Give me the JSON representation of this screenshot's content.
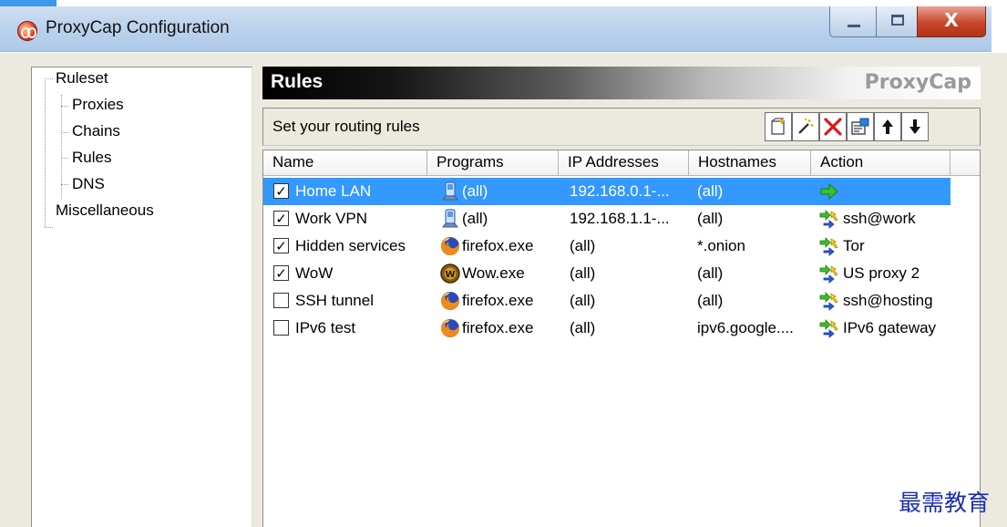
{
  "window": {
    "title": "ProxyCap Configuration",
    "close_label": "X"
  },
  "tree": {
    "root": "Ruleset",
    "children": [
      "Proxies",
      "Chains",
      "Rules",
      "DNS"
    ],
    "other": "Miscellaneous"
  },
  "rules": {
    "header": "Rules",
    "brand": "ProxyCap",
    "subtitle": "Set your routing rules",
    "toolbar": [
      "new-rule-icon",
      "wizard-icon",
      "delete-icon",
      "properties-icon",
      "move-up-icon",
      "move-down-icon"
    ],
    "columns": [
      "Name",
      "Programs",
      "IP Addresses",
      "Hostnames",
      "Action"
    ],
    "rows": [
      {
        "checked": true,
        "name": "Home LAN",
        "program": "(all)",
        "program_icon": "all-programs-icon",
        "ip": "192.168.0.1-...",
        "host": "(all)",
        "action": "",
        "action_icon": "direct-arrow-icon",
        "selected": true
      },
      {
        "checked": true,
        "name": "Work VPN",
        "program": "(all)",
        "program_icon": "all-programs-icon",
        "ip": "192.168.1.1-...",
        "host": "(all)",
        "action": "ssh@work",
        "action_icon": "proxy-route-icon",
        "selected": false
      },
      {
        "checked": true,
        "name": "Hidden services",
        "program": "firefox.exe",
        "program_icon": "firefox-icon",
        "ip": "(all)",
        "host": "*.onion",
        "action": "Tor",
        "action_icon": "proxy-route-icon",
        "selected": false
      },
      {
        "checked": true,
        "name": "WoW",
        "program": "Wow.exe",
        "program_icon": "wow-icon",
        "ip": "(all)",
        "host": "(all)",
        "action": "US proxy 2",
        "action_icon": "proxy-route-icon",
        "selected": false
      },
      {
        "checked": false,
        "name": "SSH tunnel",
        "program": "firefox.exe",
        "program_icon": "firefox-icon",
        "ip": "(all)",
        "host": "(all)",
        "action": "ssh@hosting",
        "action_icon": "proxy-route-icon",
        "selected": false
      },
      {
        "checked": false,
        "name": "IPv6 test",
        "program": "firefox.exe",
        "program_icon": "firefox-icon",
        "ip": "(all)",
        "host": "ipv6.google....",
        "action": "IPv6 gateway",
        "action_icon": "proxy-route-icon",
        "selected": false
      }
    ]
  },
  "watermark": "最需教育",
  "colors": {
    "selection": "#3399ff",
    "watermark": "#1a2fb0"
  }
}
